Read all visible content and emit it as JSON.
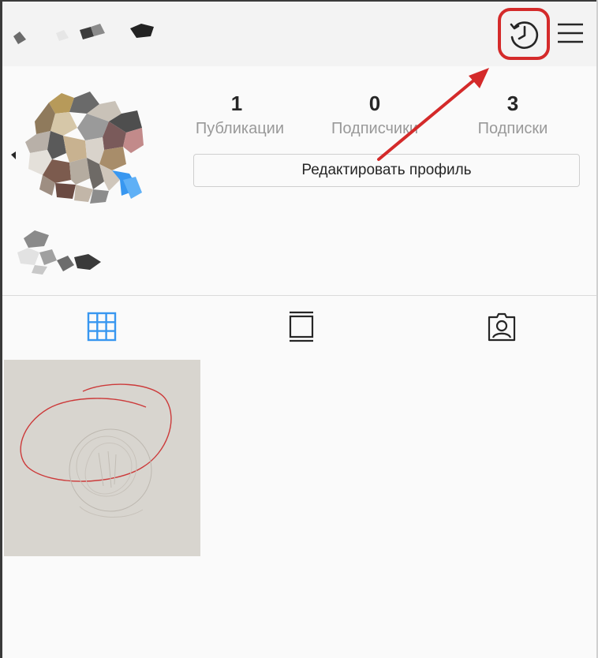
{
  "header": {
    "history_icon": "history-icon",
    "menu_icon": "hamburger-menu-icon"
  },
  "stats": {
    "posts_count": "1",
    "posts_label": "Публикации",
    "followers_count": "0",
    "followers_label": "Подписчики",
    "following_count": "3",
    "following_label": "Подписки"
  },
  "profile": {
    "edit_button_label": "Редактировать профиль"
  },
  "tabs": [
    {
      "icon": "grid-icon",
      "active": true
    },
    {
      "icon": "feed-icon",
      "active": false
    },
    {
      "icon": "tagged-person-icon",
      "active": false
    }
  ],
  "colors": {
    "annotation_red": "#d42a2a",
    "active_tab_blue": "#3897f0",
    "inactive_icon": "#262626"
  }
}
